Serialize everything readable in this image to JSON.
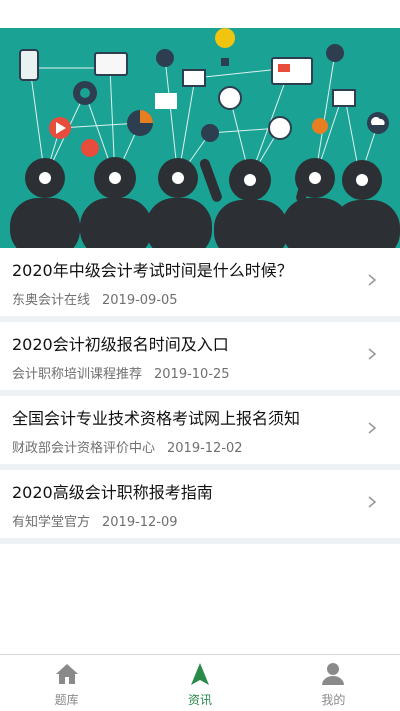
{
  "news": [
    {
      "title": "2020年中级会计考试时间是什么时候？",
      "source": "东奥会计在线",
      "date": "2019-09-05"
    },
    {
      "title": "2020会计初级报名时间及入口",
      "source": "会计职称培训课程推荐",
      "date": "2019-10-25"
    },
    {
      "title": "全国会计专业技术资格考试网上报名须知",
      "source": "财政部会计资格评价中心",
      "date": "2019-12-02"
    },
    {
      "title": "2020高级会计职称报考指南",
      "source": "有知学堂官方",
      "date": "2019-12-09"
    }
  ],
  "tabs": [
    {
      "label": "题库",
      "icon": "home-icon"
    },
    {
      "label": "资讯",
      "icon": "navigation-arrow-icon",
      "active": true
    },
    {
      "label": "我的",
      "icon": "user-icon"
    }
  ],
  "colors": {
    "banner_bg": "#1aa394",
    "accent": "#2a8a4a",
    "tab_inactive": "#8a8a8a"
  }
}
